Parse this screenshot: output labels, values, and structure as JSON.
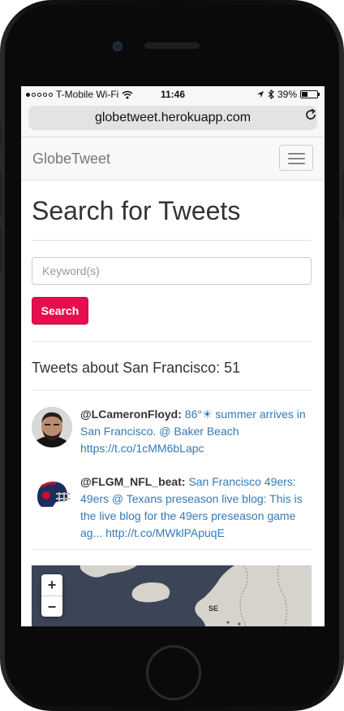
{
  "status_bar": {
    "carrier": "T-Mobile Wi-Fi",
    "time": "11:46",
    "battery": "39%"
  },
  "browser": {
    "url": "globetweet.herokuapp.com"
  },
  "navbar": {
    "brand": "GlobeTweet"
  },
  "search": {
    "title": "Search for Tweets",
    "placeholder": "Keyword(s)",
    "button_label": "Search"
  },
  "results": {
    "heading": "Tweets about San Francisco: 51",
    "tweets": [
      {
        "handle": "@LCameronFloyd:",
        "text": "86°☀ summer arrives in San Francisco. @ Baker Beach https://t.co/1cMM6bLapc"
      },
      {
        "handle": "@FLGM_NFL_beat:",
        "text": "San Francisco 49ers: 49ers @ Texans preseason live blog: This is the live blog for the 49ers preseason game ag... http://t.co/MWklPApuqE"
      }
    ]
  },
  "map": {
    "zoom_in": "+",
    "zoom_out": "−",
    "country_label": "SE"
  }
}
